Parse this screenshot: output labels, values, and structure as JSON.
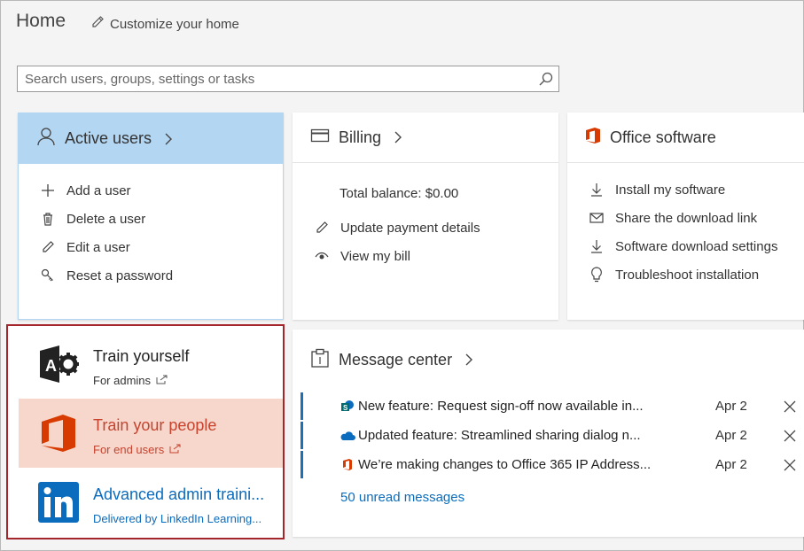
{
  "header": {
    "title": "Home",
    "customize_label": "Customize your home"
  },
  "search": {
    "placeholder": "Search users, groups, settings or tasks",
    "value": ""
  },
  "active_users": {
    "title": "Active users",
    "items": [
      {
        "label": "Add a user",
        "icon": "plus-icon"
      },
      {
        "label": "Delete a user",
        "icon": "trash-icon"
      },
      {
        "label": "Edit a user",
        "icon": "pencil-icon"
      },
      {
        "label": "Reset a password",
        "icon": "key-icon"
      }
    ]
  },
  "billing": {
    "title": "Billing",
    "balance": "Total balance: $0.00",
    "items": [
      {
        "label": "Update payment details",
        "icon": "pencil-icon"
      },
      {
        "label": "View my bill",
        "icon": "eye-icon"
      }
    ]
  },
  "office": {
    "title": "Office software",
    "items": [
      {
        "label": "Install my software",
        "icon": "download-icon"
      },
      {
        "label": "Share the download link",
        "icon": "mail-icon"
      },
      {
        "label": "Software download settings",
        "icon": "download-icon"
      },
      {
        "label": "Troubleshoot installation",
        "icon": "lightbulb-icon"
      }
    ]
  },
  "training": {
    "items": [
      {
        "title": "Train yourself",
        "subtitle": "For admins",
        "icon": "admin-gear-logo"
      },
      {
        "title": "Train your people",
        "subtitle": "For end users",
        "icon": "office-logo"
      },
      {
        "title": "Advanced admin traini...",
        "subtitle": "Delivered by LinkedIn Learning...",
        "icon": "linkedin-logo"
      }
    ]
  },
  "message_center": {
    "title": "Message center",
    "messages": [
      {
        "text": "New feature: Request sign-off now available in...",
        "date": "Apr 2",
        "icon": "sharepoint-icon"
      },
      {
        "text": "Updated feature: Streamlined sharing dialog n...",
        "date": "Apr 2",
        "icon": "onedrive-icon"
      },
      {
        "text": "We’re making changes to Office 365 IP Address...",
        "date": "Apr 2",
        "icon": "office-icon"
      }
    ],
    "unread_label": "50 unread messages"
  },
  "colors": {
    "active_users_header": "#b3d6f2",
    "highlight_border": "#a4262c",
    "office_orange": "#d83b01",
    "train_people_bg": "#f7d7cc",
    "link_blue": "#0b6cbd",
    "message_bar": "#1f6fb5"
  }
}
